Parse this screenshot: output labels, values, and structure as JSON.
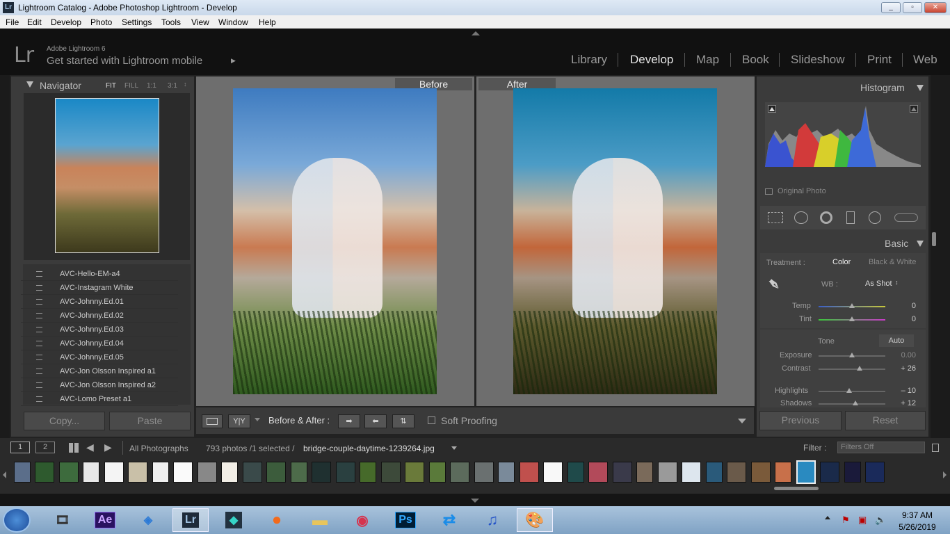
{
  "window": {
    "title": "Lightroom Catalog - Adobe Photoshop Lightroom - Develop",
    "icon": "Lr",
    "min": "_",
    "max": "▫",
    "close": "✕"
  },
  "menu": [
    "File",
    "Edit",
    "Develop",
    "Photo",
    "Settings",
    "Tools",
    "View",
    "Window",
    "Help"
  ],
  "header": {
    "logo": "Lr",
    "product": "Adobe Lightroom 6",
    "tagline": "Get started with Lightroom mobile",
    "arrow": "▶",
    "modules": [
      "Library",
      "Develop",
      "Map",
      "Book",
      "Slideshow",
      "Print",
      "Web"
    ],
    "active_module": "Develop"
  },
  "navigator": {
    "title": "Navigator",
    "zoom": [
      "FIT",
      "FILL",
      "1:1",
      "3:1"
    ]
  },
  "presets": [
    "AVC-Hello-EM-a4",
    "AVC-Instagram White",
    "AVC-Johnny.Ed.01",
    "AVC-Johnny.Ed.02",
    "AVC-Johnny.Ed.03",
    "AVC-Johnny.Ed.04",
    "AVC-Johnny.Ed.05",
    "AVC-Jon Olsson Inspired a1",
    "AVC-Jon Olsson Inspired a2",
    "AVC-Lomo Preset a1"
  ],
  "left_buttons": {
    "copy": "Copy...",
    "paste": "Paste"
  },
  "compare": {
    "before": "Before",
    "after": "After"
  },
  "toolbar": {
    "view_label": "Y|Y",
    "mode": "Before & After :",
    "soft_proofing": "Soft Proofing"
  },
  "histogram": {
    "title": "Histogram",
    "original_photo": "Original Photo"
  },
  "basic": {
    "title": "Basic",
    "treatment_label": "Treatment :",
    "color": "Color",
    "bw": "Black & White",
    "wb_label": "WB :",
    "wb_value": "As Shot",
    "temp": {
      "label": "Temp",
      "value": "0"
    },
    "tint": {
      "label": "Tint",
      "value": "0"
    },
    "tone_label": "Tone",
    "auto": "Auto",
    "exposure": {
      "label": "Exposure",
      "value": "0.00"
    },
    "contrast": {
      "label": "Contrast",
      "value": "+ 26"
    },
    "highlights": {
      "label": "Highlights",
      "value": "– 10"
    },
    "shadows": {
      "label": "Shadows",
      "value": "+ 12"
    }
  },
  "right_buttons": {
    "previous": "Previous",
    "reset": "Reset"
  },
  "filmbar": {
    "screen1": "1",
    "screen2": "2",
    "source": "All Photographs",
    "count": "793 photos /1 selected /",
    "filename": "bridge-couple-daytime-1239264.jpg",
    "filter_label": "Filter :",
    "filter_value": "Filters Off"
  },
  "clock": {
    "time": "9:37 AM",
    "date": "5/26/2019"
  },
  "taskbar_apps": [
    "media-player",
    "Ae",
    "network",
    "Lr",
    "filmora",
    "firefox",
    "explorer",
    "camera",
    "Ps",
    "teamviewer",
    "audio",
    "paint"
  ],
  "colors": {
    "accent": "#c8c8c8",
    "dark": "#111111",
    "panel": "#3b3b3b"
  }
}
